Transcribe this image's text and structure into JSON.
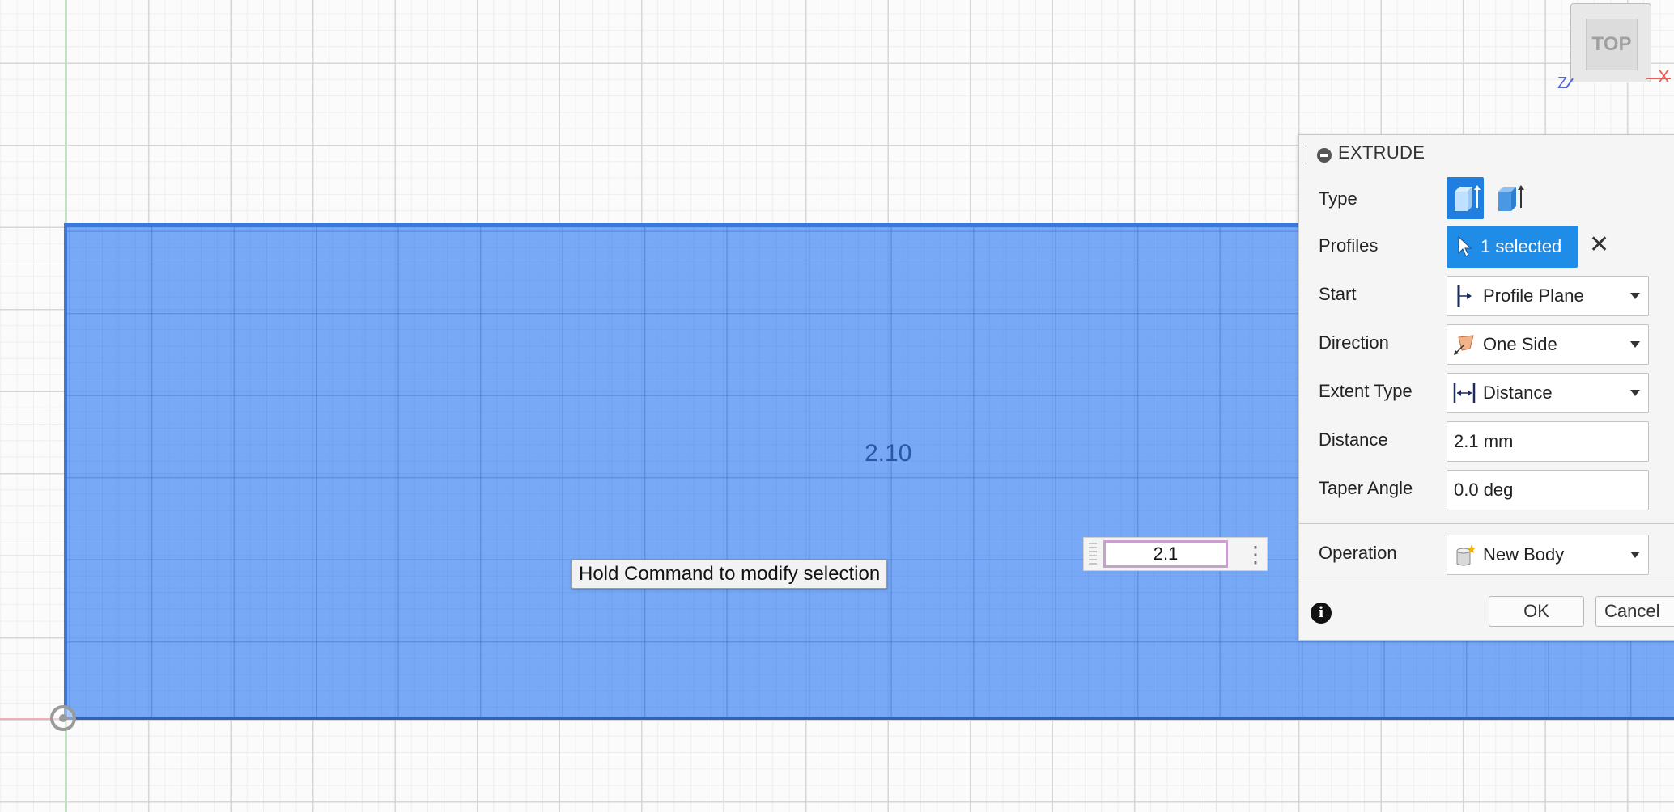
{
  "viewport": {
    "dimension_label": "2.10",
    "hint": "Hold Command to modify selection",
    "inline_distance_value": "2.1",
    "viewcube": {
      "face_label": "TOP",
      "x_axis_label": "X",
      "z_axis_label": "Z"
    },
    "profile_color": "#5a96f5"
  },
  "panel": {
    "title": "EXTRUDE",
    "rows": {
      "type": {
        "label": "Type"
      },
      "profiles": {
        "label": "Profiles",
        "value": "1 selected"
      },
      "start": {
        "label": "Start",
        "value": "Profile Plane"
      },
      "direction": {
        "label": "Direction",
        "value": "One Side"
      },
      "extent_type": {
        "label": "Extent Type",
        "value": "Distance"
      },
      "distance": {
        "label": "Distance",
        "value": "2.1 mm"
      },
      "taper_angle": {
        "label": "Taper Angle",
        "value": "0.0 deg"
      },
      "operation": {
        "label": "Operation",
        "value": "New Body"
      }
    },
    "buttons": {
      "ok": "OK",
      "cancel": "Cancel"
    },
    "accent_color": "#1f8ce8"
  }
}
